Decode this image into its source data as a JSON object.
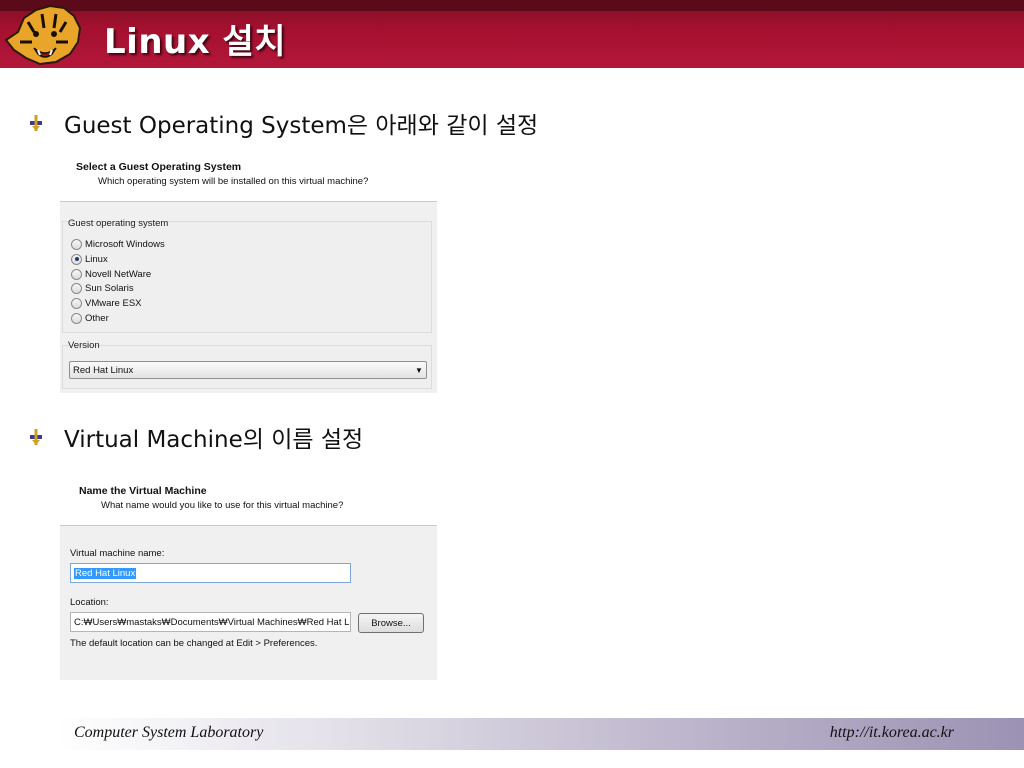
{
  "slide": {
    "title": "Linux 설치"
  },
  "bullets": [
    {
      "text": "Guest Operating System은 아래와 같이 설정"
    },
    {
      "text": "Virtual Machine의 이름 설정"
    }
  ],
  "guest_os_dialog": {
    "heading": "Select a Guest Operating System",
    "subheading": "Which operating system will be installed on this virtual machine?",
    "group_label": "Guest operating system",
    "options": [
      {
        "label": "Microsoft Windows",
        "checked": false
      },
      {
        "label": "Linux",
        "checked": true
      },
      {
        "label": "Novell NetWare",
        "checked": false
      },
      {
        "label": "Sun Solaris",
        "checked": false
      },
      {
        "label": "VMware ESX",
        "checked": false
      },
      {
        "label": "Other",
        "checked": false
      }
    ],
    "version_label": "Version",
    "version_value": "Red Hat Linux"
  },
  "name_dialog": {
    "heading": "Name the Virtual Machine",
    "subheading": "What name would you like to use for this virtual machine?",
    "vm_name_label": "Virtual machine name:",
    "vm_name_value": "Red Hat Linux",
    "location_label": "Location:",
    "location_value": "C:₩Users₩mastaks₩Documents₩Virtual Machines₩Red Hat L",
    "browse_label": "Browse...",
    "note": "The default location can be changed at Edit > Preferences."
  },
  "footer": {
    "left": "Computer System Laboratory",
    "right": "http://it.korea.ac.kr"
  },
  "colors": {
    "header": "#a4102f",
    "accent_selection": "#3399ff"
  }
}
